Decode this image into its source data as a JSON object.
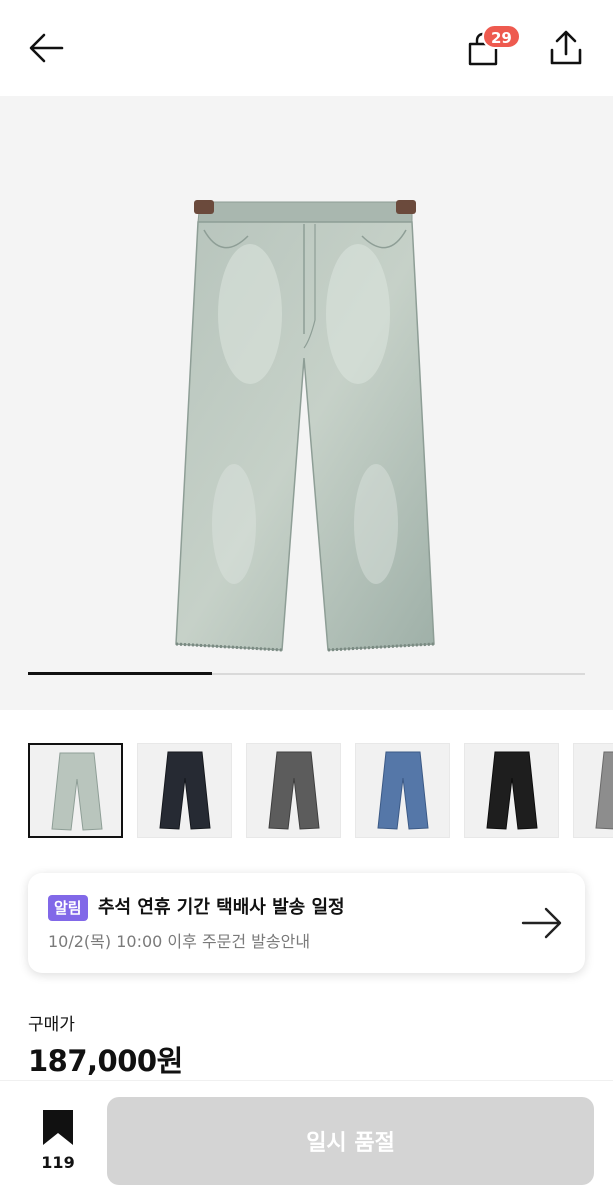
{
  "header": {
    "back_icon": "arrow-left-icon",
    "cart_icon": "shopping-bag-icon",
    "cart_count": "29",
    "share_icon": "share-upload-icon"
  },
  "gallery": {
    "image_position": 1,
    "image_total": 3,
    "progress_fraction": 0.33,
    "thumbnails": [
      {
        "color": "light-wash",
        "selected": true
      },
      {
        "color": "black-navy",
        "selected": false
      },
      {
        "color": "charcoal",
        "selected": false
      },
      {
        "color": "blue",
        "selected": false
      },
      {
        "color": "black",
        "selected": false
      },
      {
        "color": "grey",
        "selected": false
      }
    ]
  },
  "notice": {
    "badge": "알림",
    "title": "추석 연휴 기간 택배사 발송 일정",
    "subtitle": "10/2(목) 10:00 이후 주문건 발송안내",
    "arrow_icon": "arrow-right-icon"
  },
  "price": {
    "label": "구매가",
    "value": "187,000원"
  },
  "bottom": {
    "bookmark_icon": "bookmark-icon",
    "bookmark_count": "119",
    "soldout_label": "일시 품절"
  },
  "colors": {
    "badge_red": "#ee5a4f",
    "notice_purple": "#8168e8",
    "disabled_grey": "#d4d4d4"
  }
}
